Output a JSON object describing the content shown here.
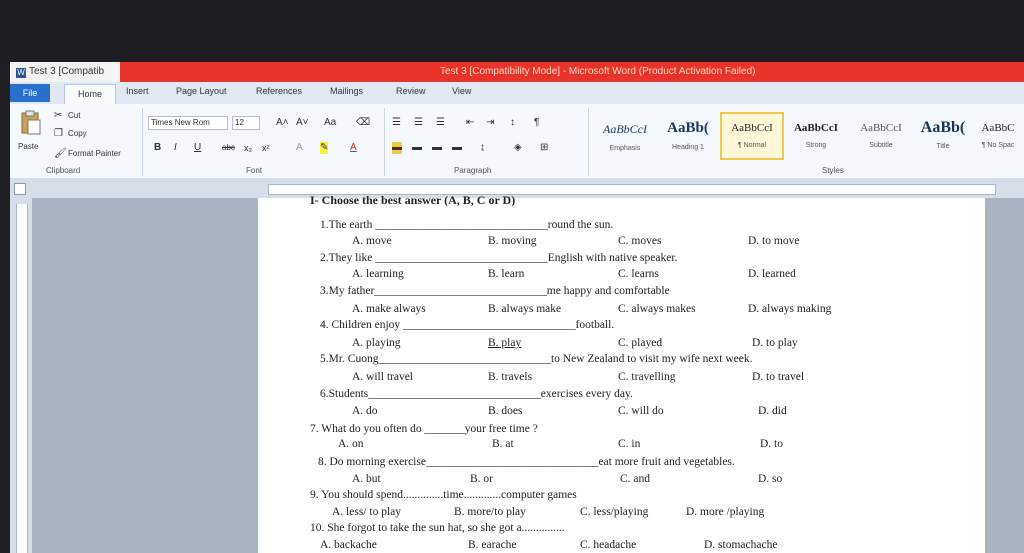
{
  "window": {
    "tab_title": "Test 3 [Compatib",
    "title": "Test 3 [Compatibility Mode] - Microsoft Word (Product Activation Failed)"
  },
  "ribbon_tabs": [
    "File",
    "Home",
    "Insert",
    "Page Layout",
    "References",
    "Mailings",
    "Review",
    "View"
  ],
  "clipboard": {
    "paste": "Paste",
    "cut": "Cut",
    "copy": "Copy",
    "format_painter": "Format Painter",
    "label": "Clipboard"
  },
  "font": {
    "name": "Times New Rom",
    "size": "12",
    "label": "Font"
  },
  "paragraph": {
    "label": "Paragraph"
  },
  "styles": {
    "label": "Styles",
    "items": [
      {
        "preview": "AaBbCcI",
        "name": "Emphasis"
      },
      {
        "preview": "AaBb(",
        "name": "Heading 1"
      },
      {
        "preview": "AaBbCcI",
        "name": "¶ Normal"
      },
      {
        "preview": "AaBbCcI",
        "name": "Strong"
      },
      {
        "preview": "AaBbCcI",
        "name": "Subtitle"
      },
      {
        "preview": "AaBb(",
        "name": "Title"
      },
      {
        "preview": "AaBbC",
        "name": "¶ No Spac"
      }
    ]
  },
  "document": {
    "header_cut": "I- Choose the best answer (A, B, C or D)",
    "questions": [
      {
        "stem": "1.The earth ______________________________round the sun.",
        "options": [
          "A. move",
          "B. moving",
          "C. moves",
          "D. to move"
        ]
      },
      {
        "stem": "2.They like ______________________________English with native speaker.",
        "options": [
          "A. learning",
          "B. learn",
          "C. learns",
          "D. learned"
        ]
      },
      {
        "stem": "3.My father______________________________me happy and comfortable",
        "options": [
          "A. make always",
          "B. always make",
          "C. always makes",
          "D. always making"
        ]
      },
      {
        "stem": "4. Children enjoy ______________________________football.",
        "options": [
          "A. playing",
          "B. play",
          "C. played",
          "D. to play"
        ]
      },
      {
        "stem": "5.Mr. Cuong______________________________to New Zealand to visit my wife next week.",
        "options": [
          "A. will travel",
          "B. travels",
          "C. travelling",
          "D. to travel"
        ]
      },
      {
        "stem": "6.Students______________________________exercises every day.",
        "options": [
          "A. do",
          "B. does",
          "C. will do",
          "D. did"
        ]
      },
      {
        "stem": "7. What do you often do _______your free time ?",
        "options": [
          "A. on",
          "B. at",
          "C. in",
          "D. to"
        ]
      },
      {
        "stem": "8. Do morning exercise______________________________eat more fruit and vegetables.",
        "options": [
          "A. but",
          "B. or",
          "C. and",
          "D. so"
        ]
      },
      {
        "stem": "9. You should spend..............time.............computer games",
        "options": [
          "A. less/ to play",
          "B. more/to play",
          "C. less/playing",
          "D. more /playing"
        ]
      },
      {
        "stem": "10. She forgot to take the sun hat, so she got a...............",
        "options": [
          "A. backache",
          "B. earache",
          "C. headache",
          "D. stomachache"
        ]
      }
    ]
  }
}
